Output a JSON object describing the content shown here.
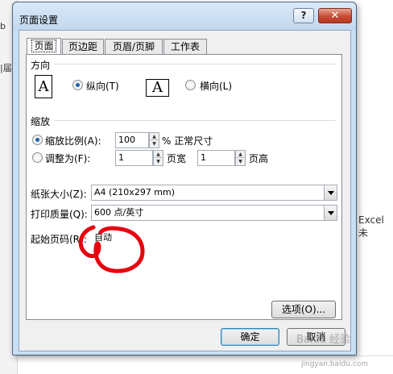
{
  "background": {
    "left_text_1": "b",
    "left_text_2": "|届",
    "right_text": "Excel 未"
  },
  "dialog": {
    "title": "页面设置",
    "help_label": "?",
    "close_label": "✕"
  },
  "tabs": [
    {
      "label": "页面",
      "active": true
    },
    {
      "label": "页边距",
      "active": false
    },
    {
      "label": "页眉/页脚",
      "active": false
    },
    {
      "label": "工作表",
      "active": false
    }
  ],
  "orientation": {
    "heading": "方向",
    "portrait_label": "纵向(T)",
    "landscape_label": "横向(L)",
    "icon_letter": "A",
    "selected": "portrait"
  },
  "scaling": {
    "heading": "缩放",
    "adjust_label": "缩放比例(A):",
    "adjust_value": "100",
    "percent_suffix": "% 正常尺寸",
    "fit_label": "调整为(F):",
    "fit_wide_value": "1",
    "fit_wide_suffix": "页宽",
    "fit_tall_value": "1",
    "fit_tall_suffix": "页高",
    "selected": "adjust"
  },
  "paper_size": {
    "label": "纸张大小(Z):",
    "value": "A4 (210x297 mm)"
  },
  "print_quality": {
    "label": "打印质量(Q):",
    "value": "600 点/英寸"
  },
  "first_page": {
    "label": "起始页码(R):",
    "value": "自动"
  },
  "buttons": {
    "options": "选项(O)...",
    "ok": "确定",
    "cancel": "取消"
  },
  "watermark": {
    "logo": "Baidu 经验",
    "url": "jingyan.baidu.com"
  },
  "colors": {
    "title_bar": "#c2d8ef",
    "close_button": "#c74b34",
    "annotation": "#e8000e"
  }
}
